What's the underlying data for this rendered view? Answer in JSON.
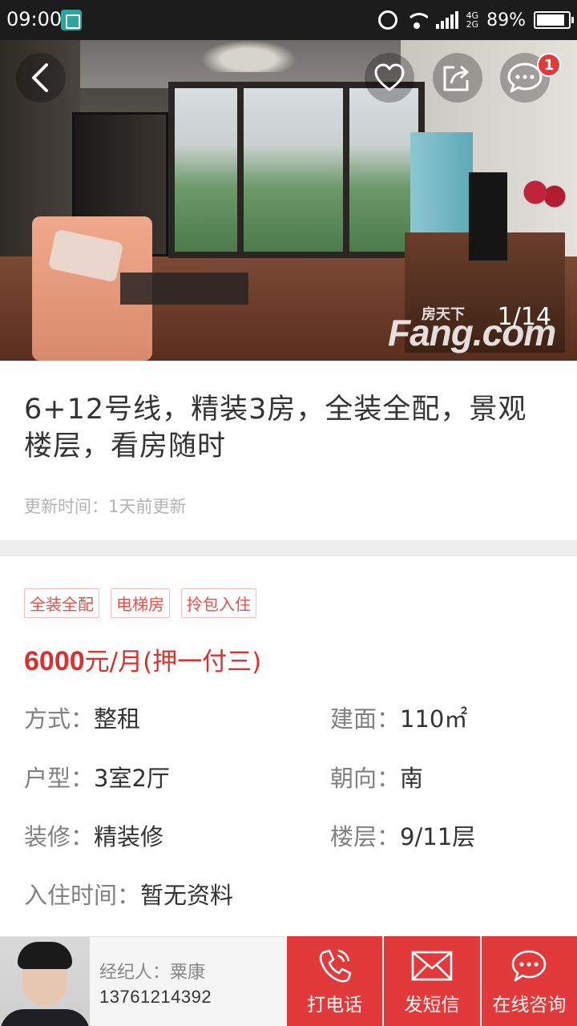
{
  "status_bar": {
    "time": "09:00",
    "battery": "89%",
    "battery_level": 0.89,
    "network_top": "4G",
    "network_bottom": "2G"
  },
  "gallery": {
    "counter": "1/14",
    "watermark_cn": "房天下",
    "watermark_en": "Fang.com",
    "message_badge": "1"
  },
  "listing": {
    "title": "6+12号线，精装3房，全装全配，景观楼层，看房随时",
    "update_time": "更新时间：1天前更新",
    "tags": [
      "全装全配",
      "电梯房",
      "拎包入住"
    ],
    "price_amount": "6000",
    "price_unit": "元/月(押一付三)",
    "details": {
      "mode_label": "方式：",
      "mode_value": "整租",
      "area_label": "建面：",
      "area_value": "110㎡",
      "layout_label": "户型：",
      "layout_value": "3室2厅",
      "orientation_label": "朝向：",
      "orientation_value": "南",
      "decoration_label": "装修：",
      "decoration_value": "精装修",
      "floor_label": "楼层：",
      "floor_value": "9/11层",
      "movein_label": "入住时间：",
      "movein_value": "暂无资料"
    }
  },
  "agent": {
    "name": "经纪人：粟康",
    "phone": "13761214392"
  },
  "actions": {
    "call": "打电话",
    "sms": "发短信",
    "chat": "在线咨询"
  },
  "colors": {
    "accent": "#e2393a",
    "price": "#d8322e",
    "tag_text": "#e2504a"
  }
}
